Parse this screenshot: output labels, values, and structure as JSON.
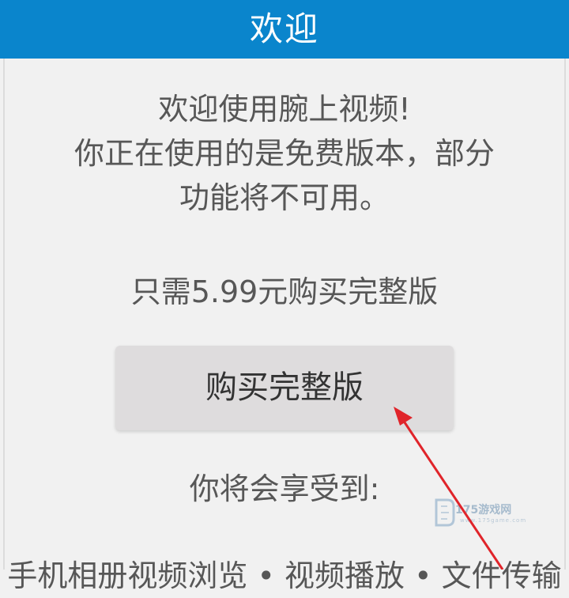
{
  "header": {
    "title": "欢迎"
  },
  "intro": {
    "lines": [
      "欢迎使用腕上视频!",
      "你正在使用的是免费版本，部分",
      "功能将不可用。"
    ]
  },
  "price": {
    "text": "只需5.99元购买完整版"
  },
  "buy_button": {
    "label": "购买完整版"
  },
  "benefits": {
    "heading": "你将会享受到:",
    "cut_line": "手机相册视频浏览 • 视频播放 • 文件传输"
  },
  "watermark": {
    "text": "175游戏网",
    "sub": "www.175game.com"
  },
  "colors": {
    "header_bg": "#0a85cc",
    "page_bg": "#f1f1f1",
    "button_bg": "#dedcdd",
    "text": "#575757",
    "arrow": "#e0242a"
  }
}
